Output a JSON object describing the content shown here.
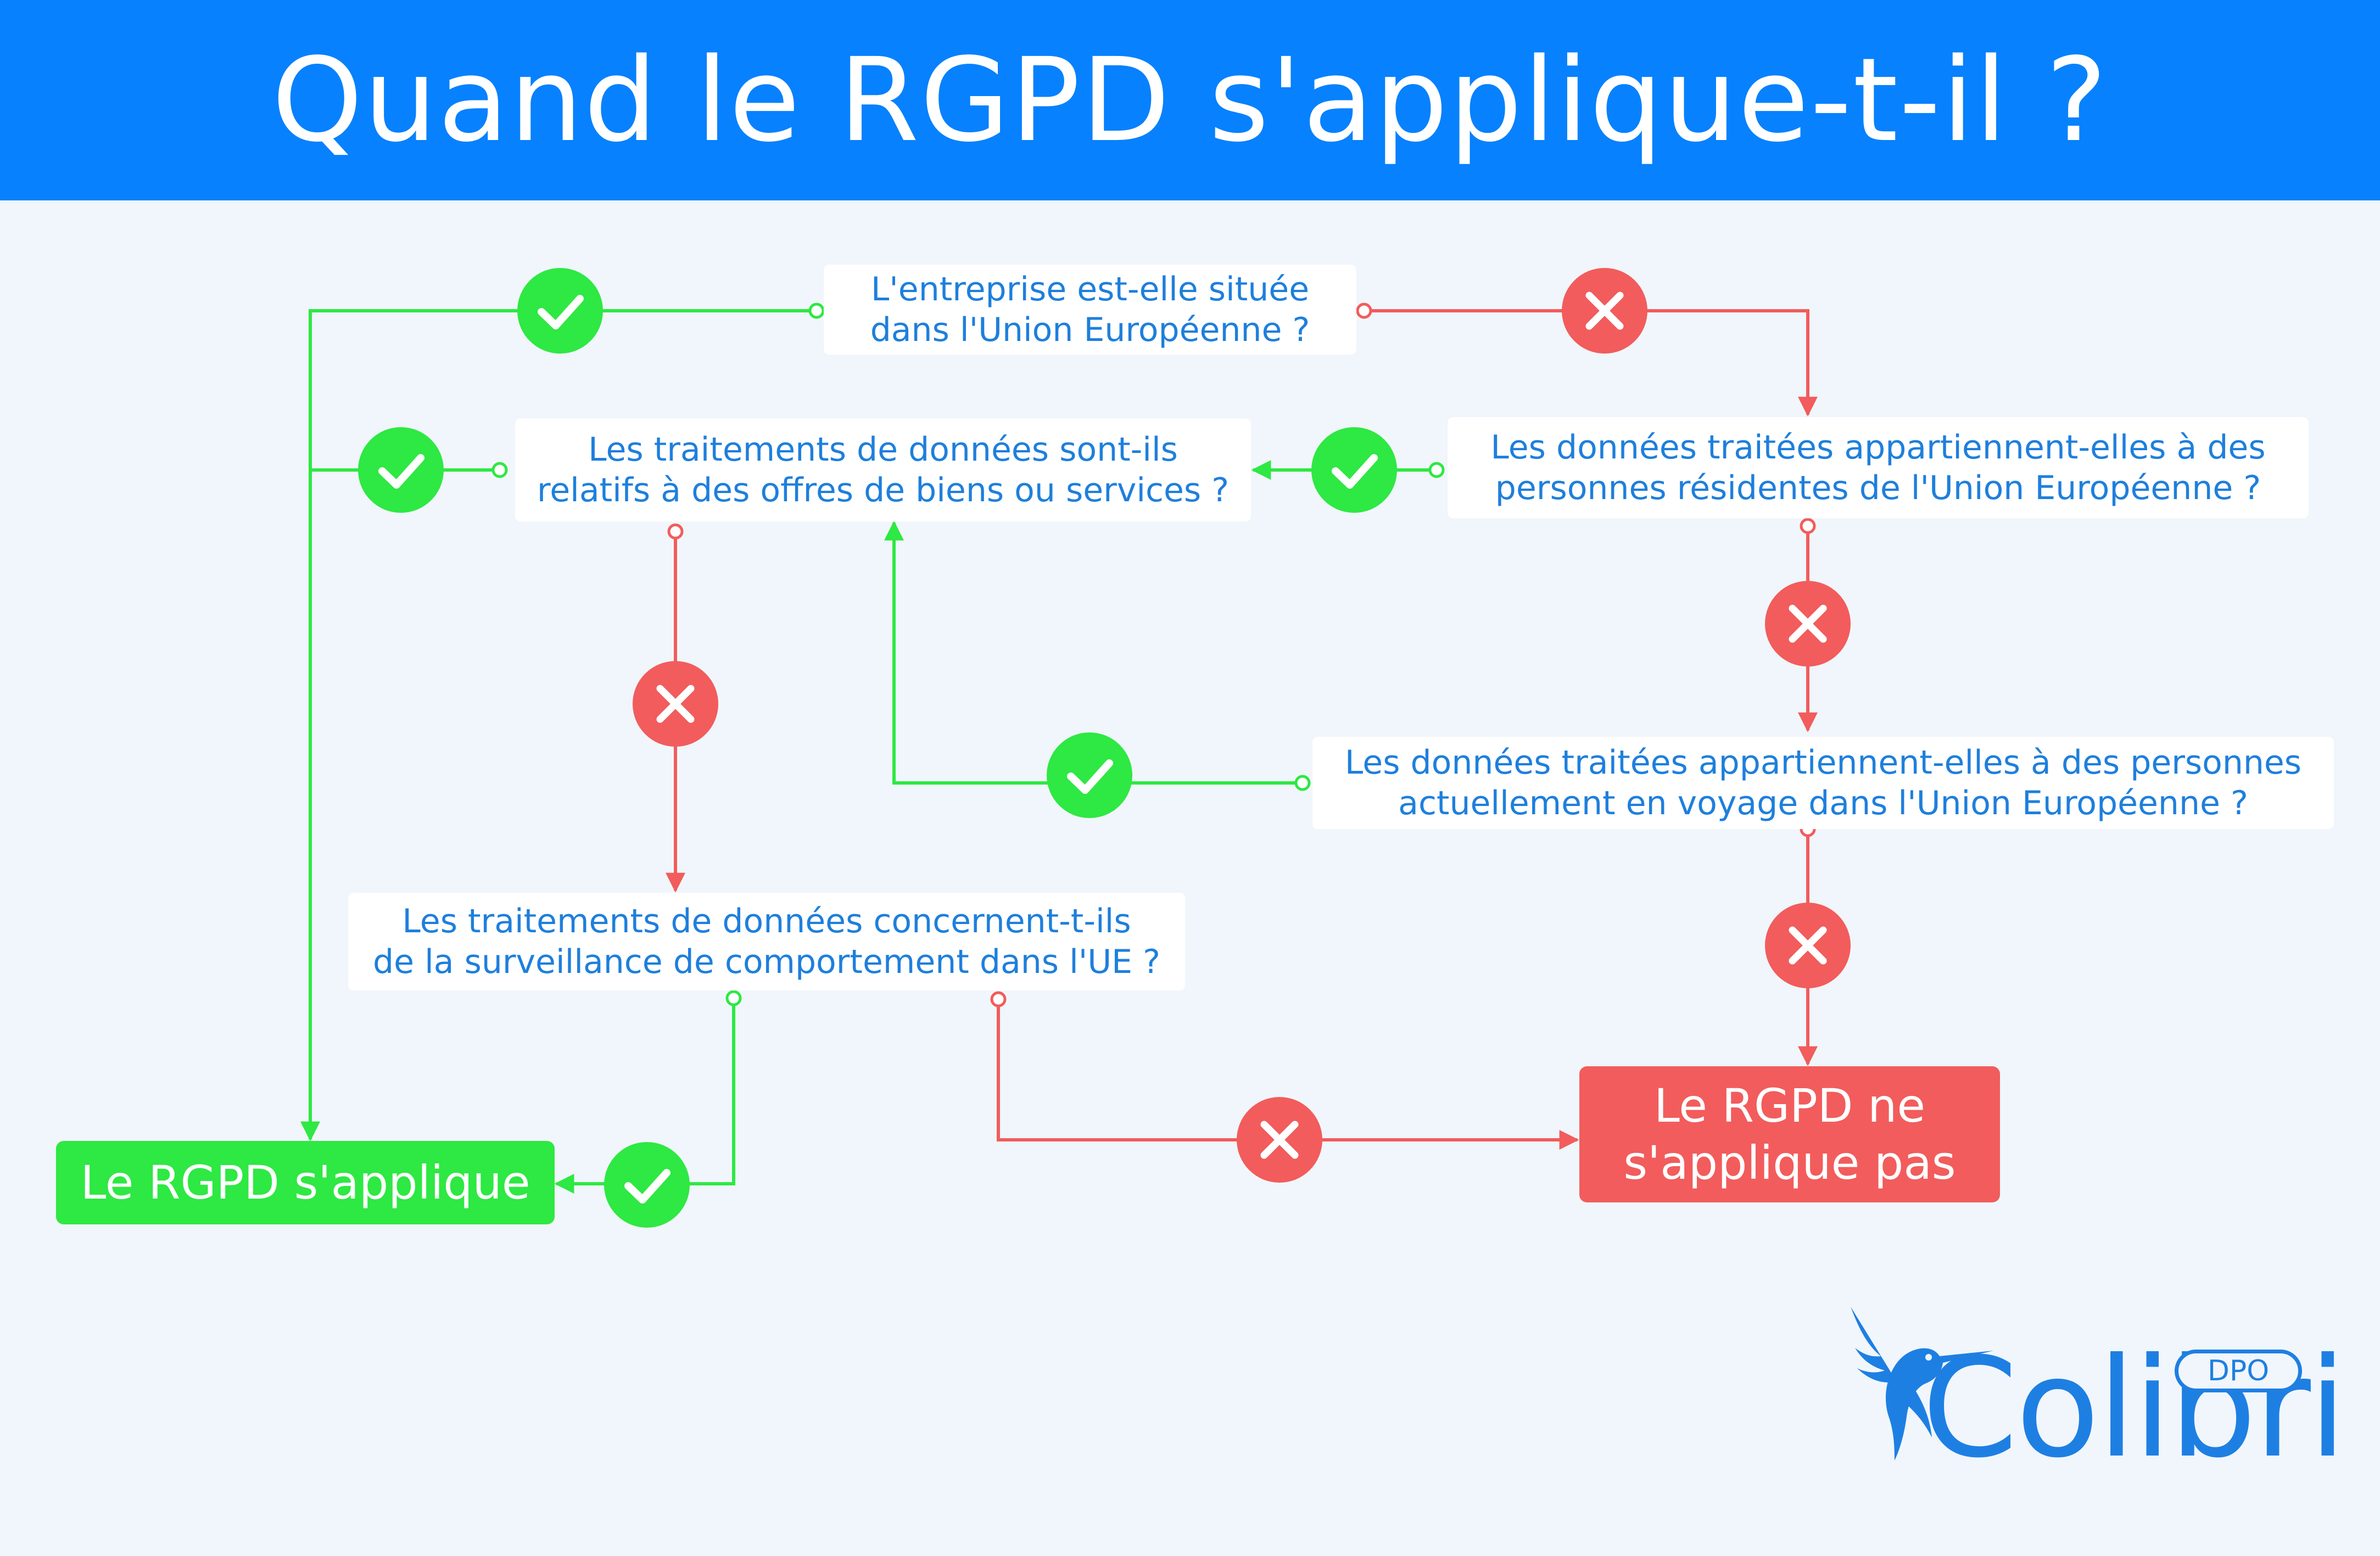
{
  "title": "Quand le RGPD s'applique-t-il ?",
  "colors": {
    "header": "#0781fd",
    "yes": "#2ee843",
    "no": "#f25c5c",
    "question_text": "#1e7fdc",
    "background": "#f0f6fb",
    "brand": "#1e7fe3"
  },
  "icons": {
    "yes": "check-icon",
    "no": "cross-icon"
  },
  "questions": {
    "q1": {
      "line1": "L'entreprise est-elle située",
      "line2": "dans l'Union Européenne ?"
    },
    "q2": {
      "line1": "Les traitements de données sont-ils",
      "line2": "relatifs à des offres de biens ou services ?"
    },
    "q3": {
      "line1": "Les données traitées appartiennent-elles à des",
      "line2": "personnes résidentes de l'Union Européenne ?"
    },
    "q4": {
      "line1": "Les données traitées appartiennent-elles à des personnes",
      "line2": "actuellement en voyage dans l'Union Européenne ?"
    },
    "q5": {
      "line1": "Les traitements de données concernent-t-ils",
      "line2": "de la surveillance de comportement dans l'UE ?"
    }
  },
  "results": {
    "applies": "Le RGPD s'applique",
    "not_applies_line1": "Le RGPD ne",
    "not_applies_line2": "s'applique pas"
  },
  "brand": {
    "name": "Colibri",
    "badge": "DPO"
  }
}
